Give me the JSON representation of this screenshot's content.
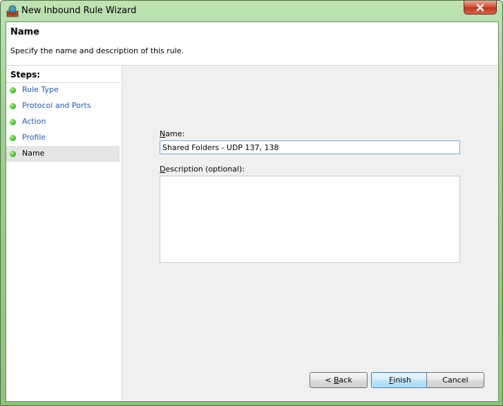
{
  "window": {
    "title": "New Inbound Rule Wizard",
    "colors": {
      "accent": "#9fcf8f",
      "close": "#c1371d",
      "link": "#1e5aa8"
    }
  },
  "header": {
    "title": "Name",
    "subtitle": "Specify the name and description of this rule."
  },
  "steps": {
    "title": "Steps:",
    "items": [
      {
        "label": "Rule Type",
        "active": false
      },
      {
        "label": "Protocol and Ports",
        "active": false
      },
      {
        "label": "Action",
        "active": false
      },
      {
        "label": "Profile",
        "active": false
      },
      {
        "label": "Name",
        "active": true
      }
    ]
  },
  "form": {
    "name_label_prefix": "N",
    "name_label_rest": "ame:",
    "name_value": "Shared Folders - UDP 137, 138",
    "desc_label_prefix": "D",
    "desc_label_rest": "escription (optional):",
    "desc_value": ""
  },
  "buttons": {
    "back_prefix": "< ",
    "back_u": "B",
    "back_rest": "ack",
    "finish_u": "F",
    "finish_rest": "inish",
    "cancel": "Cancel"
  },
  "icons": {
    "title_icon": "firewall-icon",
    "close_icon": "close-icon",
    "step_icon": "green-dot-icon"
  }
}
